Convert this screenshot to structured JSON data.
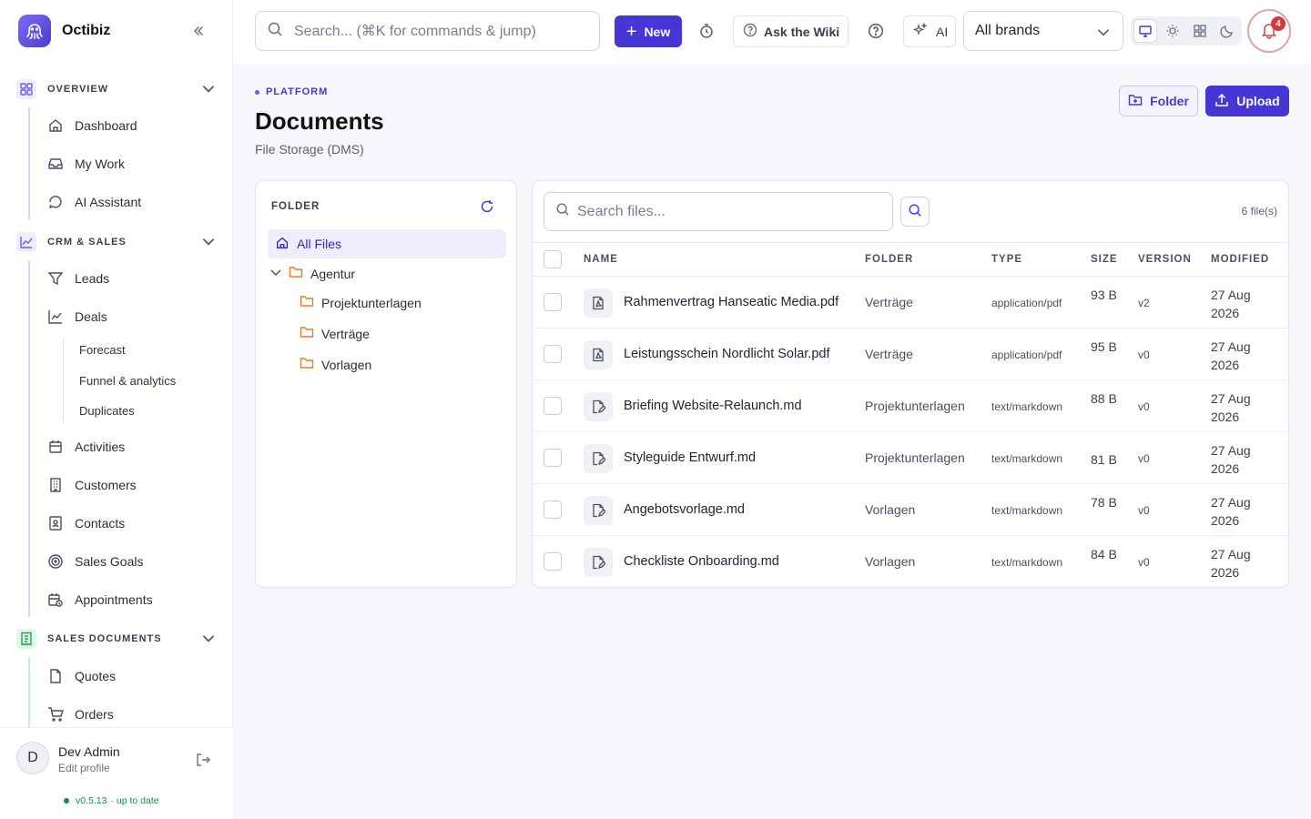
{
  "app": {
    "name": "Octibiz",
    "collapse_icon": "double-chevron-left-icon"
  },
  "sidebar": {
    "sections": [
      {
        "label": "OVERVIEW",
        "icon": "grid-icon",
        "color": "#6a5ce8"
      },
      {
        "label": "CRM & SALES",
        "icon": "chart-line-icon",
        "color": "#6a5ce8"
      },
      {
        "label": "SALES DOCUMENTS",
        "icon": "receipt-icon",
        "color": "#22a15a"
      }
    ],
    "items": [
      {
        "label": "Dashboard",
        "icon": "home-icon"
      },
      {
        "label": "My Work",
        "icon": "inbox-icon"
      },
      {
        "label": "AI Assistant",
        "icon": "chat-icon"
      },
      {
        "label": "Leads",
        "icon": "funnel-icon"
      },
      {
        "label": "Deals",
        "icon": "chart-icon"
      },
      {
        "label": "Activities",
        "icon": "calendar-icon"
      },
      {
        "label": "Customers",
        "icon": "building-icon"
      },
      {
        "label": "Contacts",
        "icon": "contact-card-icon"
      },
      {
        "label": "Sales Goals",
        "icon": "target-icon"
      },
      {
        "label": "Appointments",
        "icon": "calendar-clock-icon"
      },
      {
        "label": "Quotes",
        "icon": "file-icon"
      },
      {
        "label": "Orders",
        "icon": "cart-icon"
      }
    ],
    "deals_sub": [
      "Forecast",
      "Funnel & analytics",
      "Duplicates"
    ]
  },
  "user": {
    "initial": "D",
    "name": "Dev Admin",
    "edit": "Edit profile",
    "version": "v0.5.13",
    "version_status": "· up to date"
  },
  "topbar": {
    "search_placeholder": "Search... (⌘K for commands & jump)",
    "new_label": "New",
    "wiki_label": "Ask the Wiki",
    "ai_label": "AI",
    "brand_select": "All brands",
    "notifications": "4",
    "accent": "#4636d6"
  },
  "page": {
    "breadcrumb": "PLATFORM",
    "title": "Documents",
    "subtitle": "File Storage (DMS)",
    "folder_btn": "Folder",
    "upload_btn": "Upload"
  },
  "folders": {
    "title": "FOLDER",
    "all": "All Files",
    "root": "Agentur",
    "children": [
      "Projektunterlagen",
      "Verträge",
      "Vorlagen"
    ]
  },
  "files": {
    "search_placeholder": "Search files...",
    "count": "6 file(s)",
    "columns": [
      "NAME",
      "FOLDER",
      "TYPE",
      "SIZE",
      "VERSION",
      "MODIFIED"
    ],
    "rows": [
      {
        "name": "Rahmenvertrag Hanseatic Media.pdf",
        "folder": "Verträge",
        "type": "application/pdf",
        "size": "93 B",
        "version": "v2",
        "modified": "27 Aug 2026",
        "icon": "pdf-file-icon"
      },
      {
        "name": "Leistungsschein Nordlicht Solar.pdf",
        "folder": "Verträge",
        "type": "application/pdf",
        "size": "95 B",
        "version": "v0",
        "modified": "27 Aug 2026",
        "icon": "pdf-file-icon"
      },
      {
        "name": "Briefing Website-Relaunch.md",
        "folder": "Projektunterlagen",
        "type": "text/markdown",
        "size": "88 B",
        "version": "v0",
        "modified": "27 Aug 2026",
        "icon": "edit-file-icon"
      },
      {
        "name": "Styleguide Entwurf.md",
        "folder": "Projektunterlagen",
        "type": "text/markdown",
        "size": "81 B",
        "version": "v0",
        "modified": "27 Aug 2026",
        "icon": "edit-file-icon"
      },
      {
        "name": "Angebotsvorlage.md",
        "folder": "Vorlagen",
        "type": "text/markdown",
        "size": "78 B",
        "version": "v0",
        "modified": "27 Aug 2026",
        "icon": "edit-file-icon"
      },
      {
        "name": "Checkliste Onboarding.md",
        "folder": "Vorlagen",
        "type": "text/markdown",
        "size": "84 B",
        "version": "v0",
        "modified": "27 Aug 2026",
        "icon": "edit-file-icon"
      }
    ]
  }
}
